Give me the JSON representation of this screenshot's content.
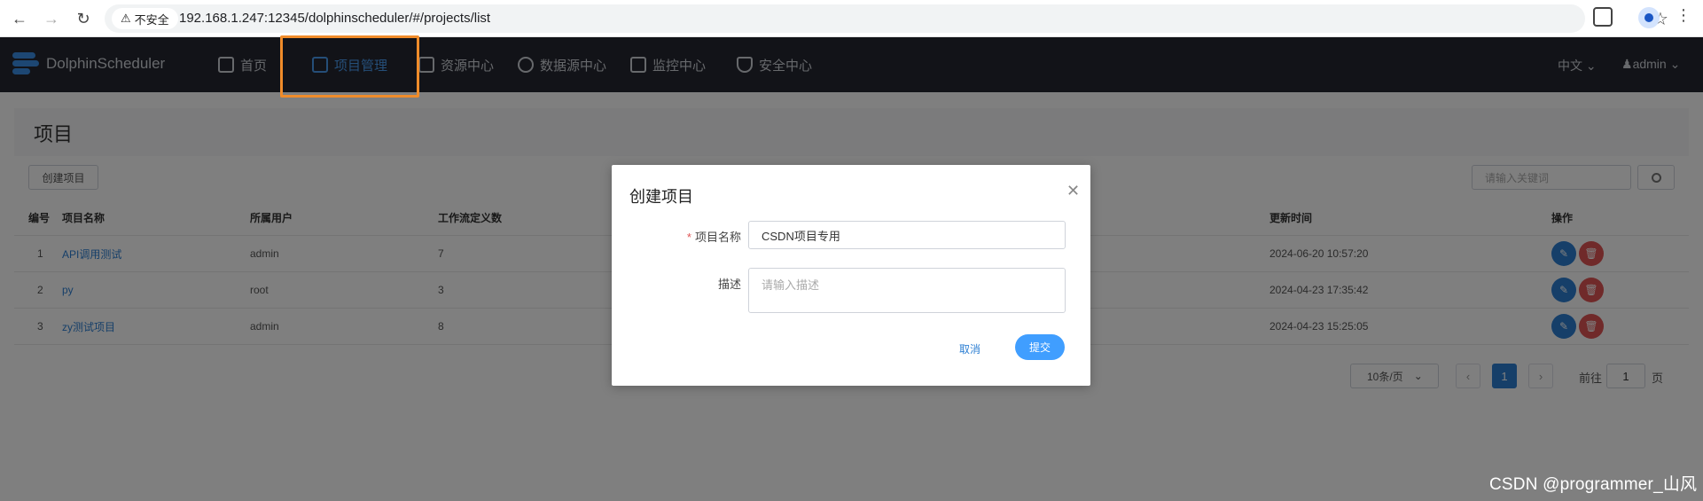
{
  "browser": {
    "insecure_label": "不安全",
    "url": "192.168.1.247:12345/dolphinscheduler/#/projects/list"
  },
  "header": {
    "app_name": "DolphinScheduler",
    "nav": [
      "首页",
      "项目管理",
      "资源中心",
      "数据源中心",
      "监控中心",
      "安全中心"
    ],
    "active_nav": "项目管理",
    "language": "中文",
    "user": "admin"
  },
  "page": {
    "title": "项目",
    "create_button": "创建项目",
    "search_placeholder": "请输入关键词",
    "columns": {
      "index": "编号",
      "name": "项目名称",
      "owner": "所属用户",
      "workflow_count": "工作流定义数",
      "update_time": "更新时间",
      "ops": "操作"
    },
    "rows": [
      {
        "index": "1",
        "name": "API调用测试",
        "owner": "admin",
        "workflow_count": "7",
        "update_time": "2024-06-20 10:57:20"
      },
      {
        "index": "2",
        "name": "py",
        "owner": "root",
        "workflow_count": "3",
        "update_time": "2024-04-23 17:35:42"
      },
      {
        "index": "3",
        "name": "zy测试项目",
        "owner": "admin",
        "workflow_count": "8",
        "update_time": "2024-04-23 15:25:05"
      }
    ],
    "pagination": {
      "page_size": "10条/页",
      "current_page": "1",
      "goto_prefix": "前往",
      "goto_value": "1",
      "goto_suffix": "页"
    }
  },
  "dialog": {
    "title": "创建项目",
    "name_label": "项目名称",
    "name_value": "CSDN项目专用",
    "desc_label": "描述",
    "desc_placeholder": "请输入描述",
    "cancel": "取消",
    "submit": "提交"
  },
  "watermark": "CSDN @programmer_山风",
  "colors": {
    "header_bg": "#242731",
    "accent": "#409eff",
    "highlight": "#f08c2a",
    "danger": "#e05555"
  }
}
